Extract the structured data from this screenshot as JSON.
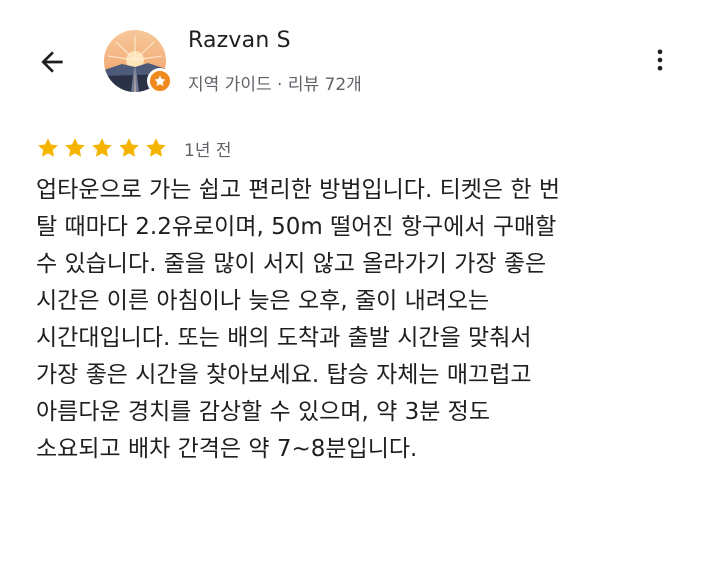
{
  "header": {
    "back_icon": "arrow-back-icon",
    "menu_icon": "more-vertical-icon"
  },
  "user": {
    "name": "Razvan S",
    "subtitle": "지역 가이드 · 리뷰 72개",
    "avatar_icon": "sunset-road-avatar",
    "badge_icon": "local-guide-star-icon",
    "badge_color": "#f08a1c"
  },
  "review": {
    "rating": 5,
    "rating_max": 5,
    "star_color": "#f4b400",
    "date": "1년 전",
    "lines": [
      "업타운으로 가는 쉽고 편리한 방법입니다. 티켓은 한 번",
      "탈 때마다 2.2유로이며, 50m 떨어진 항구에서 구매할",
      "수 있습니다. 줄을 많이 서지 않고 올라가기 가장 좋은",
      "시간은 이른 아침이나 늦은 오후, 줄이 내려오는",
      "시간대입니다. 또는 배의 도착과 출발 시간을 맞춰서",
      "가장 좋은 시간을 찾아보세요. 탑승 자체는 매끄럽고",
      "아름다운 경치를 감상할 수 있으며, 약 3분 정도",
      "소요되고 배차 간격은 약 7~8분입니다."
    ]
  }
}
